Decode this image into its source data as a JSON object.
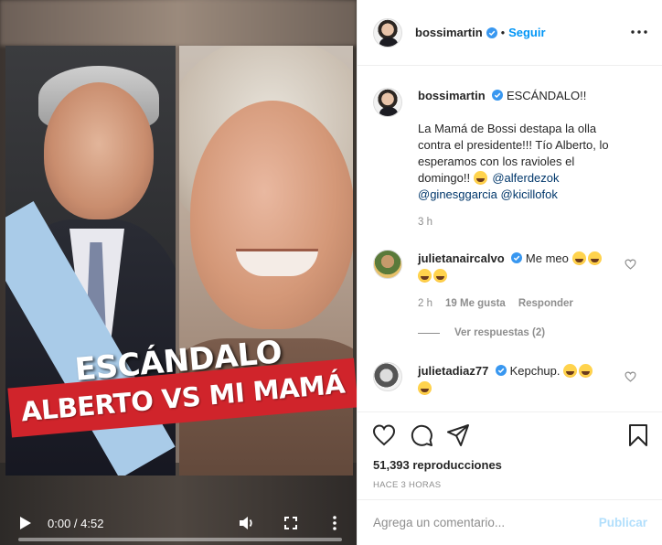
{
  "video": {
    "overlay_top": "ESCÁNDALO",
    "overlay_bottom": "ALBERTO VS MI MAMÁ",
    "time": "0:00 / 4:52",
    "progress": 0
  },
  "header": {
    "username": "bossimartin",
    "dot": "•",
    "follow_label": "Seguir"
  },
  "caption": {
    "username": "bossimartin",
    "headline": "ESCÁNDALO!!",
    "text": "La Mamá de Bossi destapa la olla contra el presidente!!! Tío Alberto, lo esperamos con los ravioles el domingo!!",
    "mention_1": "@alferdezok",
    "mention_2": "@ginesggarcia",
    "mention_3": "@kicillofok",
    "time": "3 h"
  },
  "comments": [
    {
      "username": "julietanaircalvo",
      "text": "Me meo",
      "time": "2 h",
      "likes": "19 Me gusta",
      "reply_label": "Responder",
      "emojis": 4
    },
    {
      "username": "julietadiaz77",
      "text": "Kepchup.",
      "emojis": 3
    }
  ],
  "view_replies": "Ver respuestas (2)",
  "stats": {
    "views": "51,393 reproducciones",
    "posted": "HACE 3 HORAS"
  },
  "composer": {
    "placeholder": "Agrega un comentario...",
    "publish_label": "Publicar"
  },
  "colors": {
    "accent": "#0095f6",
    "banner_red": "#d0242b",
    "publish_disabled": "#b2dffc"
  }
}
